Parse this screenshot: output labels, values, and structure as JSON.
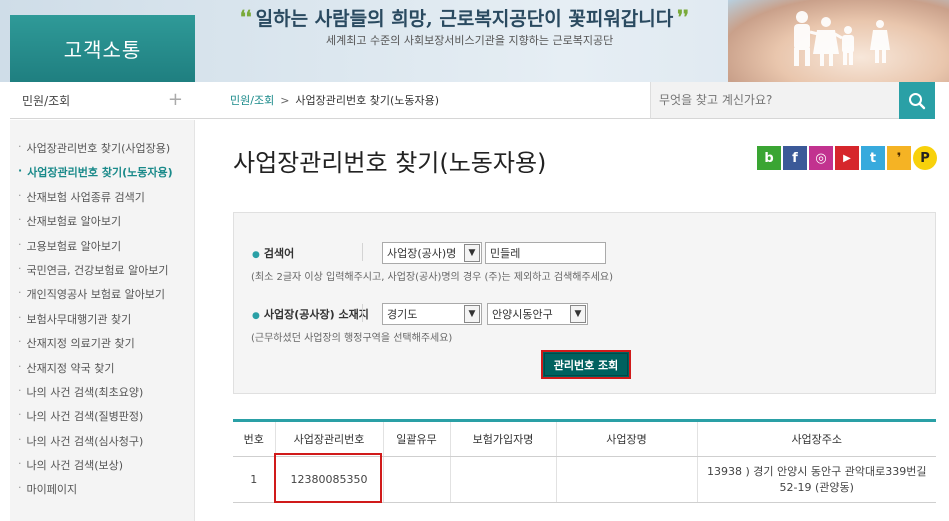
{
  "banner": {
    "logo": "고객소통",
    "slogan": "일하는 사람들의 희망, 근로복지공단이 꽃피워갑니다",
    "sub_slogan": "세계최고 수준의 사회보장서비스기관을 지향하는 근로복지공단"
  },
  "nav": {
    "header": "민원/조회",
    "items": [
      {
        "label": "사업장관리번호 찾기(사업장용)",
        "active": false
      },
      {
        "label": "사업장관리번호 찾기(노동자용)",
        "active": true
      },
      {
        "label": "산재보험 사업종류 검색기",
        "active": false
      },
      {
        "label": "산재보험료 알아보기",
        "active": false
      },
      {
        "label": "고용보험료 알아보기",
        "active": false
      },
      {
        "label": "국민연금, 건강보험료 알아보기",
        "active": false
      },
      {
        "label": "개인직영공사 보험료 알아보기",
        "active": false
      },
      {
        "label": "보험사무대행기관 찾기",
        "active": false
      },
      {
        "label": "산재지정 의료기관 찾기",
        "active": false
      },
      {
        "label": "산재지정 약국 찾기",
        "active": false
      },
      {
        "label": "나의 사건 검색(최초요양)",
        "active": false
      },
      {
        "label": "나의 사건 검색(질병판정)",
        "active": false
      },
      {
        "label": "나의 사건 검색(심사청구)",
        "active": false
      },
      {
        "label": "나의 사건 검색(보상)",
        "active": false
      },
      {
        "label": "마이페이지",
        "active": false
      }
    ]
  },
  "breadcrumb": {
    "root": "민원/조회",
    "separator": ">",
    "current": "사업장관리번호 찾기(노동자용)"
  },
  "search": {
    "placeholder": "무엇을 찾고 계신가요?"
  },
  "page_title": "사업장관리번호 찾기(노동자용)",
  "social": [
    {
      "icon": "blog-icon",
      "glyph": "b",
      "color": "#3aa533"
    },
    {
      "icon": "facebook-icon",
      "glyph": "f",
      "color": "#3b5998"
    },
    {
      "icon": "instagram-icon",
      "glyph": "◎",
      "color": "#c2328f"
    },
    {
      "icon": "youtube-icon",
      "glyph": "▶",
      "color": "#d6262c"
    },
    {
      "icon": "twitter-icon",
      "glyph": "t",
      "color": "#37aadd"
    },
    {
      "icon": "kakaostory-icon",
      "glyph": "❜",
      "color": "#f5b324"
    },
    {
      "icon": "kakaopay-icon",
      "glyph": "P",
      "color": "#f8d10b"
    }
  ],
  "form": {
    "keyword_label": "검색어",
    "keyword_type": "사업장(공사)명",
    "keyword_value": "민들레",
    "keyword_help": "(최소 2글자 이상 입력해주시고, 사업장(공사)명의 경우 (주)는 제외하고 검색해주세요)",
    "location_label": "사업장(공사장) 소재지",
    "region": "경기도",
    "district": "안양시동안구",
    "location_help": "(근무하셨던 사업장의 행정구역을 선택해주세요)",
    "submit_label": "관리번호 조회"
  },
  "table": {
    "headers": [
      "번호",
      "사업장관리번호",
      "일괄유무",
      "보험가입자명",
      "사업장명",
      "사업장주소"
    ],
    "rows": [
      [
        "1",
        "12380085350",
        "",
        "",
        "",
        "13938 ) 경기 안양시 동안구 관악대로339번길 52-19 (관양동)"
      ]
    ]
  }
}
